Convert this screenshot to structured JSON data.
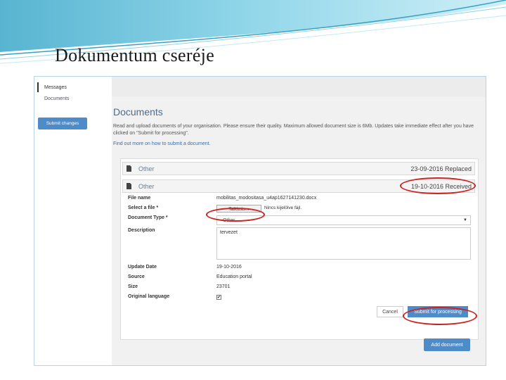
{
  "slide": {
    "title": "Dokumentum cseréje"
  },
  "sidebar": {
    "items": [
      {
        "label": "Messages"
      },
      {
        "label": "Documents"
      }
    ],
    "submit_changes_label": "Submit changes"
  },
  "main": {
    "heading": "Documents",
    "intro": "Read and upload documents of your organisation. Please ensure their quality. Maximum allowed document size is 6Mb. Updates take immediate effect after you have clicked on \"Submit for processing\".",
    "find_out_link": "Find out more on how to submit a document.",
    "documents": [
      {
        "title": "Other",
        "status": "23-09-2016 Replaced"
      },
      {
        "title": "Other",
        "status": "19-10-2016 Received"
      }
    ],
    "form": {
      "file_name_label": "File name",
      "file_name_value": "mobilitas_modositasa_u4ap1627141230.docx",
      "select_file_label": "Select a file *",
      "select_file_button": "Tallózás...",
      "no_file_text": "Nincs kijelölve fájl.",
      "document_type_label": "Document Type *",
      "document_type_value": "Other",
      "description_label": "Description",
      "description_value": "tervezet",
      "update_date_label": "Update Date",
      "update_date_value": "19-10-2016",
      "source_label": "Source",
      "source_value": "Education portal",
      "size_label": "Size",
      "size_value": "23701",
      "original_language_label": "Original language",
      "original_language_checked": "✔",
      "cancel_label": "Cancel",
      "submit_label": "Submit for processing"
    },
    "add_document_label": "Add document"
  },
  "colors": {
    "accent": "#4d8bc9",
    "highlight": "#cc2222",
    "heading": "#4a6d8c"
  }
}
